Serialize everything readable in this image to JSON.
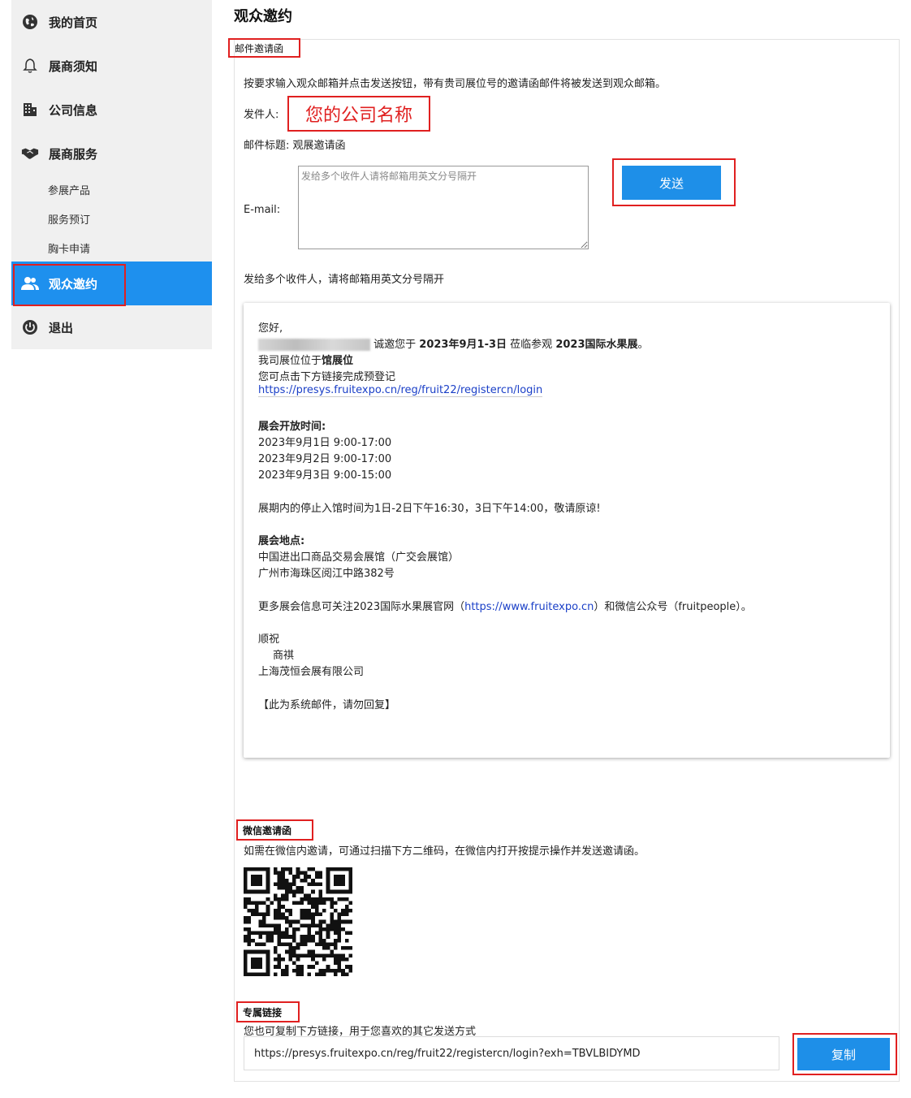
{
  "sidebar": {
    "items": [
      {
        "label": "我的首页",
        "icon": "globe-icon"
      },
      {
        "label": "展商须知",
        "icon": "bell-icon"
      },
      {
        "label": "公司信息",
        "icon": "building-icon"
      },
      {
        "label": "展商服务",
        "icon": "handshake-icon"
      }
    ],
    "sub_items": [
      "参展产品",
      "服务预订",
      "胸卡申请"
    ],
    "active_item": {
      "label": "观众邀约",
      "icon": "users-icon"
    },
    "logout": {
      "label": "退出",
      "icon": "power-icon"
    }
  },
  "page": {
    "title": "观众邀约"
  },
  "email_invite": {
    "section_label": "邮件邀请函",
    "instruction": "按要求输入观众邮箱并点击发送按钮，带有贵司展位号的邀请函邮件将被发送到观众邮箱。",
    "sender_label": "发件人:",
    "sender_value": "您的公司名称",
    "subject_label": "邮件标题:",
    "subject_value": "观展邀请函",
    "email_label": "E-mail:",
    "email_placeholder": "发给多个收件人请将邮箱用英文分号隔开",
    "send_button": "发送",
    "hint": "发给多个收件人，请将邮箱用英文分号隔开"
  },
  "mail_preview": {
    "greeting": "您好,",
    "invite_pre": "诚邀您于",
    "invite_date": "2023年9月1-3日",
    "invite_mid": "莅临参观",
    "invite_event": "2023国际水果展",
    "invite_end": "。",
    "booth_pre": "我司展位位于",
    "booth_value": "馆展位",
    "prereg_text": "您可点击下方链接完成预登记",
    "prereg_link": "https://presys.fruitexpo.cn/reg/fruit22/registercn/login",
    "hours_title": "展会开放时间:",
    "hours": [
      "2023年9月1日 9:00-17:00",
      "2023年9月2日 9:00-17:00",
      "2023年9月3日 9:00-15:00"
    ],
    "stop_entry": "展期内的停止入馆时间为1日-2日下午16:30，3日下午14:00，敬请原谅!",
    "venue_title": "展会地点:",
    "venue_lines": [
      "中国进出口商品交易会展馆（广交会展馆）",
      "广州市海珠区阅江中路382号"
    ],
    "more_pre": "更多展会信息可关注2023国际水果展官网（",
    "more_link": "https://www.fruitexpo.cn",
    "more_post": "）和微信公众号（fruitpeople）。",
    "closing1": "顺祝",
    "closing2": "商祺",
    "company": "上海茂恒会展有限公司",
    "system_note": "【此为系统邮件，请勿回复】"
  },
  "wechat_invite": {
    "section_label": "微信邀请函",
    "instruction": "如需在微信内邀请，可通过扫描下方二维码，在微信内打开按提示操作并发送邀请函。"
  },
  "exclusive_link": {
    "section_label": "专属链接",
    "instruction": "您也可复制下方链接，用于您喜欢的其它发送方式",
    "url": "https://presys.fruitexpo.cn/reg/fruit22/registercn/login?exh=TBVLBIDYMD",
    "copy_button": "复制"
  },
  "colors": {
    "accent": "#1e8fe8",
    "highlight_box": "#e02020",
    "sidebar_bg": "#f0f0f0"
  }
}
